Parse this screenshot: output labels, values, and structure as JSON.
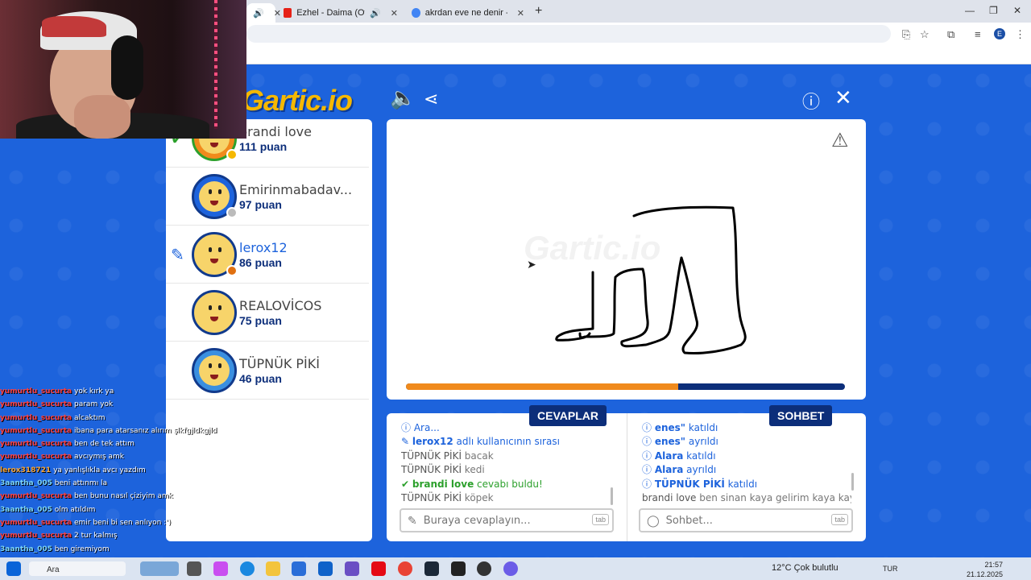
{
  "browser": {
    "tabs": [
      {
        "label": "",
        "active": true
      },
      {
        "label": "Ezhel - Daima (Official Video)",
        "favicon_color": "#e62117"
      },
      {
        "label": "akrdan eve ne denir - Google'da Ara",
        "favicon_color": "#4285f4"
      }
    ],
    "new_tab": "+",
    "window_controls": [
      "—",
      "❐",
      "✕"
    ],
    "profile_initial": "E"
  },
  "game": {
    "logo": "Gartic.io",
    "watermark": "Gartic.io",
    "progress": 0.62,
    "players": [
      {
        "name": "brandi love",
        "score": "111 puan",
        "mark": "check",
        "status_color": "#f5b800",
        "avatar_hair": "#f08a1c",
        "avatar_ring": "#2ca02c"
      },
      {
        "name": "Emirinmabadav...",
        "score": "97 puan",
        "mark": "",
        "status_color": "#bbbbbb",
        "avatar_hair": "#1d63dc",
        "avatar_ring": "#113a8c"
      },
      {
        "name": "lerox12",
        "score": "86 puan",
        "mark": "pencil",
        "status_color": "#e07010",
        "avatar_hair": "#f7d46a",
        "avatar_ring": "#113a8c"
      },
      {
        "name": "REALOVİCOS",
        "score": "75 puan",
        "mark": "",
        "status_color": "",
        "avatar_hair": "#f7d46a",
        "avatar_ring": "#113a8c"
      },
      {
        "name": "TÜPNÜK PİKİ",
        "score": "46 puan",
        "mark": "",
        "status_color": "",
        "avatar_hair": "#3a8fe0",
        "avatar_ring": "#113a8c"
      }
    ],
    "answers_label": "CEVAPLAR",
    "chat_label": "SOHBET",
    "answers": [
      {
        "type": "sys",
        "icon": "info",
        "user": "",
        "text": "Ara..."
      },
      {
        "type": "sys",
        "icon": "pencil",
        "user": "lerox12",
        "text": " adlı kullanıcının sırası"
      },
      {
        "type": "msg",
        "icon": "",
        "user": "TÜPNÜK PİKİ",
        "text": " bacak"
      },
      {
        "type": "msg",
        "icon": "",
        "user": "TÜPNÜK PİKİ",
        "text": " kedi"
      },
      {
        "type": "ok",
        "icon": "check",
        "user": "brandi love",
        "text": " cevabı buldu!"
      },
      {
        "type": "msg",
        "icon": "",
        "user": "TÜPNÜK PİKİ",
        "text": " köpek"
      }
    ],
    "chat": [
      {
        "type": "sys",
        "icon": "info",
        "user": "enes\"",
        "text": " katıldı"
      },
      {
        "type": "sys",
        "icon": "info",
        "user": "enes\"",
        "text": " ayrıldı"
      },
      {
        "type": "sys",
        "icon": "info",
        "user": "Alara",
        "text": " katıldı"
      },
      {
        "type": "sys",
        "icon": "info",
        "user": "Alara",
        "text": " ayrıldı"
      },
      {
        "type": "sys",
        "icon": "info",
        "user": "TÜPNÜK PİKİ",
        "text": " katıldı"
      },
      {
        "type": "msg",
        "icon": "",
        "user": "brandi love",
        "text": " ben sinan kaya gelirim kaya kaya"
      }
    ],
    "answer_placeholder": "Buraya cevaplayın...",
    "chat_placeholder": "Sohbet...",
    "tab_key": "tab"
  },
  "stream_chat": [
    {
      "user": "yumurtlu_sucurta",
      "text": "yok kırk ya",
      "cls": "u"
    },
    {
      "user": "yumurtlu_sucurta",
      "text": "param yok",
      "cls": "u"
    },
    {
      "user": "yumurtlu_sucurta",
      "text": "alcaktım",
      "cls": "u"
    },
    {
      "user": "yumurtlu_sucurta",
      "text": "ibana para atarsanız alırım şlkfgjldkgjld",
      "cls": "u"
    },
    {
      "user": "yumurtlu_sucurta",
      "text": "ben de tek attım",
      "cls": "u"
    },
    {
      "user": "yumurtlu_sucurta",
      "text": "avcıymış amk",
      "cls": "u"
    },
    {
      "user": "lerox318721",
      "text": "ya yanlışlıkla avcı yazdım",
      "cls": "u3"
    },
    {
      "user": "3aantha_005",
      "text": "beni attınmı la",
      "cls": "u2"
    },
    {
      "user": "yumurtlu_sucurta",
      "text": "ben bunu nasıl çiziyim amk",
      "cls": "u"
    },
    {
      "user": "3aantha_005",
      "text": "olm atıldım",
      "cls": "u2"
    },
    {
      "user": "yumurtlu_sucurta",
      "text": "emir beni bi sen anlıyon :')",
      "cls": "u"
    },
    {
      "user": "yumurtlu_sucurta",
      "text": "2 tur kalmış",
      "cls": "u"
    },
    {
      "user": "3aantha_005",
      "text": "ben giremiyom",
      "cls": "u2"
    }
  ],
  "taskbar": {
    "search_label": "Ara",
    "weather": "12°C  Çok bulutlu",
    "lang": "TUR",
    "time": "21:57",
    "date": "21.12.2025"
  }
}
